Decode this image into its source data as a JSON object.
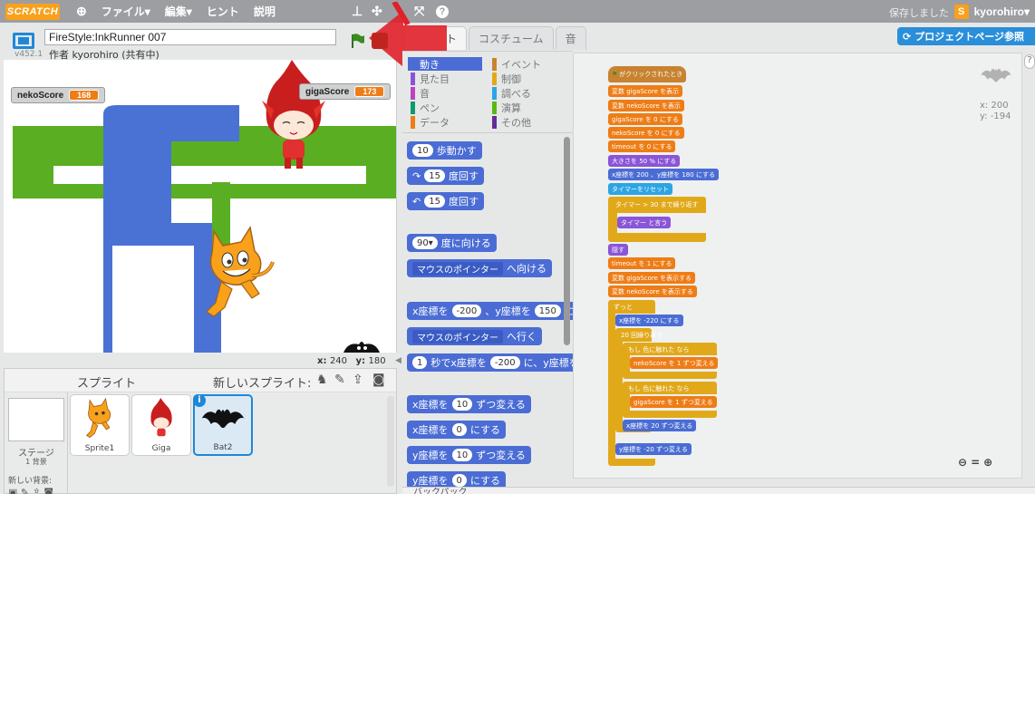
{
  "menubar": {
    "logo": "SCRATCH",
    "items": [
      "ファイル▾",
      "編集▾",
      "ヒント",
      "説明"
    ],
    "saved": "保存しました",
    "username": "kyorohiro▾"
  },
  "stage_header": {
    "version": "v452.1",
    "project_title": "FireStyle:InkRunner 007",
    "author": "作者 kyorohiro (共有中)"
  },
  "stage": {
    "monitors": [
      {
        "label": "nekoScore",
        "value": "168"
      },
      {
        "label": "gigaScore",
        "value": "173"
      }
    ],
    "coords": {
      "x_label": "x:",
      "x": "240",
      "y_label": "y:",
      "y": "180"
    }
  },
  "sprites": {
    "title": "スプライト",
    "new_sprite": "新しいスプライト:",
    "stage_label": "ステージ",
    "stage_sub": "1 背景",
    "new_backdrop": "新しい背景:",
    "items": [
      {
        "name": "Sprite1",
        "selected": false
      },
      {
        "name": "Giga",
        "selected": false
      },
      {
        "name": "Bat2",
        "selected": true
      }
    ]
  },
  "tabs": [
    "スクリプト",
    "コスチューム",
    "音"
  ],
  "tabs_visible": [
    "ト",
    "コスチューム",
    "音"
  ],
  "project_page_button": "プロジェクトページ参照",
  "categories": [
    {
      "label": "動き",
      "color": "#4a6cd4"
    },
    {
      "label": "イベント",
      "color": "#c88330"
    },
    {
      "label": "見た目",
      "color": "#8a55d7"
    },
    {
      "label": "制御",
      "color": "#e1a91a"
    },
    {
      "label": "音",
      "color": "#bb42c3"
    },
    {
      "label": "調べる",
      "color": "#2ca5e2"
    },
    {
      "label": "ペン",
      "color": "#0e9a6c"
    },
    {
      "label": "演算",
      "color": "#5cb712"
    },
    {
      "label": "データ",
      "color": "#ee7d16"
    },
    {
      "label": "その他",
      "color": "#632d99"
    }
  ],
  "palette_blocks": {
    "move": {
      "value": "10",
      "text": "歩動かす"
    },
    "turn_right": {
      "value": "15",
      "text": "度回す"
    },
    "turn_left": {
      "value": "15",
      "text": "度回す"
    },
    "point_dir": {
      "value": "90▾",
      "text": "度に向ける"
    },
    "point_towards": {
      "dd": "マウスのポインター",
      "text": "へ向ける"
    },
    "goto_xy": {
      "t1": "x座標を",
      "v1": "-200",
      "t2": "、y座標を",
      "v2": "150",
      "t3": "に"
    },
    "goto": {
      "dd": "マウスのポインター",
      "text": "へ行く"
    },
    "glide": {
      "v1": "1",
      "t1": "秒でx座標を",
      "v2": "-200",
      "t2": "に、y座標を"
    },
    "change_x": {
      "t1": "x座標を",
      "v": "10",
      "t2": "ずつ変える"
    },
    "set_x": {
      "t1": "x座標を",
      "v": "0",
      "t2": "にする"
    },
    "change_y": {
      "t1": "y座標を",
      "v": "10",
      "t2": "ずつ変える"
    },
    "set_y": {
      "t1": "y座標を",
      "v": "0",
      "t2": "にする"
    }
  },
  "backpack": "バックパック",
  "script": {
    "hat": "がクリックされたとき",
    "blocks": [
      "変数 gigaScore を表示",
      "変数 nekoScore を表示",
      "gigaScore を 0 にする",
      "nekoScore を 0 にする",
      "timeout を 0 にする",
      "大きさを 50 % にする",
      "x座標を 200 、y座標を 180 にする",
      "タイマーをリセット",
      "タイマー > 30 まで繰り返す",
      "タイマー と言う",
      "隠す",
      "timeout を 1 にする",
      "変数 gigaScore を表示する",
      "変数 nekoScore を表示する",
      "ずっと",
      "x座標を -220 にする",
      "20 回繰り返す",
      "もし 色に触れた なら",
      "nekoScore を 1 ずつ変える",
      "もし 色に触れた なら",
      "gigaScore を 1 ずつ変える",
      "x座標を 20 ずつ変える",
      "y座標を -20 ずつ変える"
    ],
    "xy_info": {
      "x": "x: 200",
      "y": "y: -194"
    }
  }
}
